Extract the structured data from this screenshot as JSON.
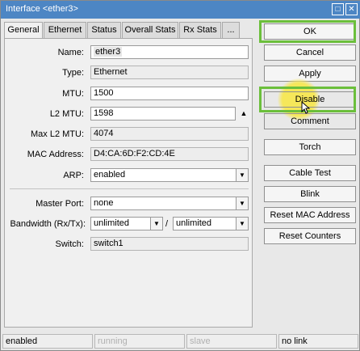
{
  "window": {
    "title": "Interface <ether3>",
    "maximize_glyph": "□",
    "close_glyph": "✕"
  },
  "tabs": [
    "General",
    "Ethernet",
    "Status",
    "Overall Stats",
    "Rx Stats",
    "..."
  ],
  "form": {
    "name_label": "Name:",
    "name_value": "ether3",
    "type_label": "Type:",
    "type_value": "Ethernet",
    "mtu_label": "MTU:",
    "mtu_value": "1500",
    "l2mtu_label": "L2 MTU:",
    "l2mtu_value": "1598",
    "maxl2mtu_label": "Max L2 MTU:",
    "maxl2mtu_value": "4074",
    "mac_label": "MAC Address:",
    "mac_value": "D4:CA:6D:F2:CD:4E",
    "arp_label": "ARP:",
    "arp_value": "enabled",
    "master_label": "Master Port:",
    "master_value": "none",
    "bandwidth_label": "Bandwidth (Rx/Tx):",
    "bandwidth_rx": "unlimited",
    "bandwidth_slash": "/",
    "bandwidth_tx": "unlimited",
    "switch_label": "Switch:",
    "switch_value": "switch1"
  },
  "buttons": {
    "ok": "OK",
    "cancel": "Cancel",
    "apply": "Apply",
    "disable": "Disable",
    "comment": "Comment",
    "torch": "Torch",
    "cable_test": "Cable Test",
    "blink": "Blink",
    "reset_mac": "Reset MAC Address",
    "reset_counters": "Reset Counters"
  },
  "status": {
    "state": "enabled",
    "running": "running",
    "slave": "slave",
    "link": "no link"
  },
  "colors": {
    "titlebar": "#4d86c4",
    "highlight": "#6bbf3b",
    "cursor_glow": "#f6e75a"
  },
  "icons": {
    "dropdown": "▼",
    "stepper": "▲"
  }
}
